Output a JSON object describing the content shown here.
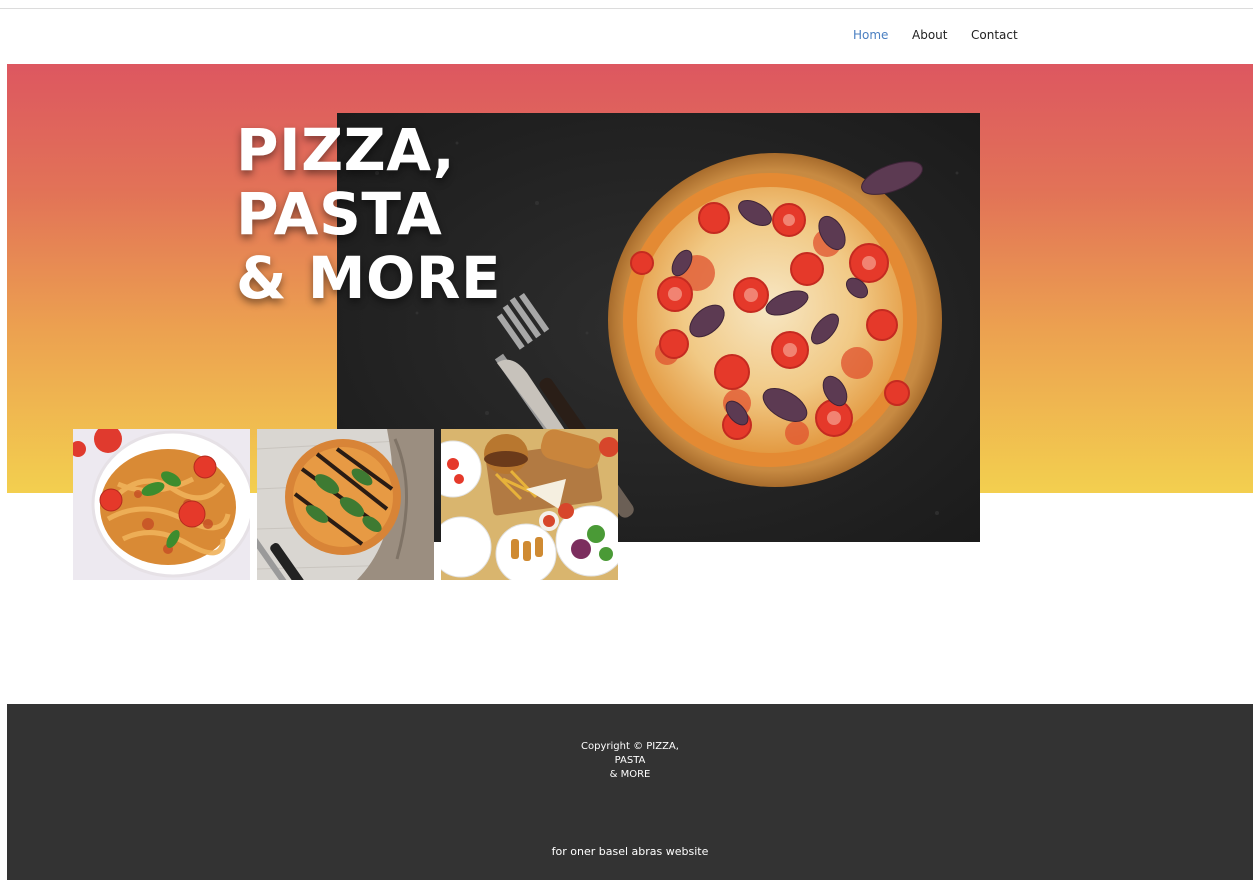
{
  "nav": {
    "items": [
      {
        "label": "Home",
        "active": true
      },
      {
        "label": "About",
        "active": false
      },
      {
        "label": "Contact",
        "active": false
      }
    ]
  },
  "hero": {
    "title_lines": [
      "PIZZA,",
      "PASTA",
      "& MORE"
    ],
    "gradient_colors": [
      "#dd5760",
      "#e27357",
      "#eca150",
      "#f3cf4f"
    ],
    "main_image": "pizza-on-wooden-board-photo"
  },
  "thumbnails": [
    {
      "image": "pasta-with-tomatoes-photo"
    },
    {
      "image": "pizza-with-basil-and-balsamic-photo"
    },
    {
      "image": "food-platter-photo"
    }
  ],
  "footer": {
    "copyright_lines": [
      "Copyright © PIZZA,",
      "PASTA",
      "& MORE"
    ],
    "credit": "for oner basel abras website",
    "background": "#333333"
  }
}
